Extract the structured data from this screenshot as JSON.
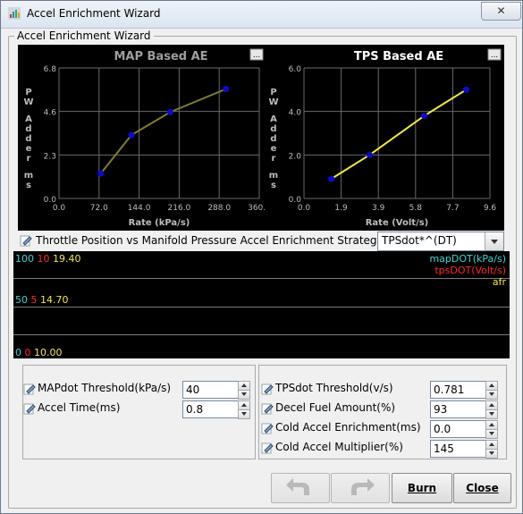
{
  "window": {
    "title": "Accel Enrichment Wizard",
    "close_glyph": "✕"
  },
  "group": {
    "title": "Accel Enrichment Wizard"
  },
  "map_chart_title": "MAP Based AE",
  "tps_chart_title": "TPS Based AE",
  "chart_data": [
    {
      "type": "line",
      "title": "MAP Based AE",
      "xlabel": "Rate (kPa/s)",
      "ylabel": "PW Adder ms",
      "x": [
        75,
        130,
        200,
        300
      ],
      "y": [
        1.3,
        3.3,
        4.5,
        5.7
      ],
      "xlim": [
        0,
        360
      ],
      "ylim": [
        0,
        6.8
      ],
      "xticks": [
        "0.0",
        "72.0",
        "144.0",
        "216.0",
        "288.0",
        "360.0"
      ],
      "yticks": [
        "0.0",
        "2.3",
        "4.6",
        "6.8"
      ],
      "grid": true,
      "colors": {
        "background": "#000000",
        "line": "#807e2e",
        "point": "#0a0ad8",
        "title": "#9e9e9e"
      },
      "more_button": "..."
    },
    {
      "type": "line",
      "title": "TPS Based AE",
      "xlabel": "Rate (Volt/s)",
      "ylabel": "PW Adder ms",
      "x": [
        0.9,
        3.0,
        6.0,
        8.3
      ],
      "y": [
        0.9,
        2.0,
        3.8,
        5.0
      ],
      "xlim": [
        -0.6,
        9.6
      ],
      "ylim": [
        0,
        6.0
      ],
      "xticks": [
        "0.0",
        "1.9",
        "3.9",
        "5.8",
        "7.7",
        "9.6"
      ],
      "yticks": [
        "0.0",
        "2.0",
        "4.0",
        "6.0"
      ],
      "grid": true,
      "colors": {
        "background": "#000000",
        "line": "#f5ea3a",
        "point": "#0a0ad8",
        "title": "#ffffff"
      },
      "more_button": "..."
    }
  ],
  "strategy": {
    "label": "Throttle Position vs Manifold Pressure Accel Enrichment Strategy",
    "selected": "TPSdot*^(DT)"
  },
  "monitor": {
    "top": {
      "a": "100",
      "b": "10",
      "c": "19.40"
    },
    "mid": {
      "a": "50",
      "b": "5",
      "c": "14.70"
    },
    "bot": {
      "a": "0",
      "b": "0",
      "c": "10.00"
    },
    "legend": [
      "mapDOT(kPa/s)",
      "tpsDOT(Volt/s)",
      "afr"
    ],
    "colors": {
      "a": "#3fd3d3",
      "b": "#ff2a2a",
      "c": "#f2e84a"
    }
  },
  "left_params": [
    {
      "label": "MAPdot Threshold(kPa/s)",
      "value": "40"
    },
    {
      "label": "Accel Time(ms)",
      "value": "0.8"
    }
  ],
  "right_params": [
    {
      "label": "TPSdot Threshold(v/s)",
      "value": "0.781"
    },
    {
      "label": "Decel Fuel Amount(%)",
      "value": "93"
    },
    {
      "label": "Cold Accel Enrichment(ms)",
      "value": "0.0"
    },
    {
      "label": "Cold Accel Multiplier(%)",
      "value": "145"
    }
  ],
  "buttons": {
    "burn": "Burn",
    "close": "Close"
  }
}
